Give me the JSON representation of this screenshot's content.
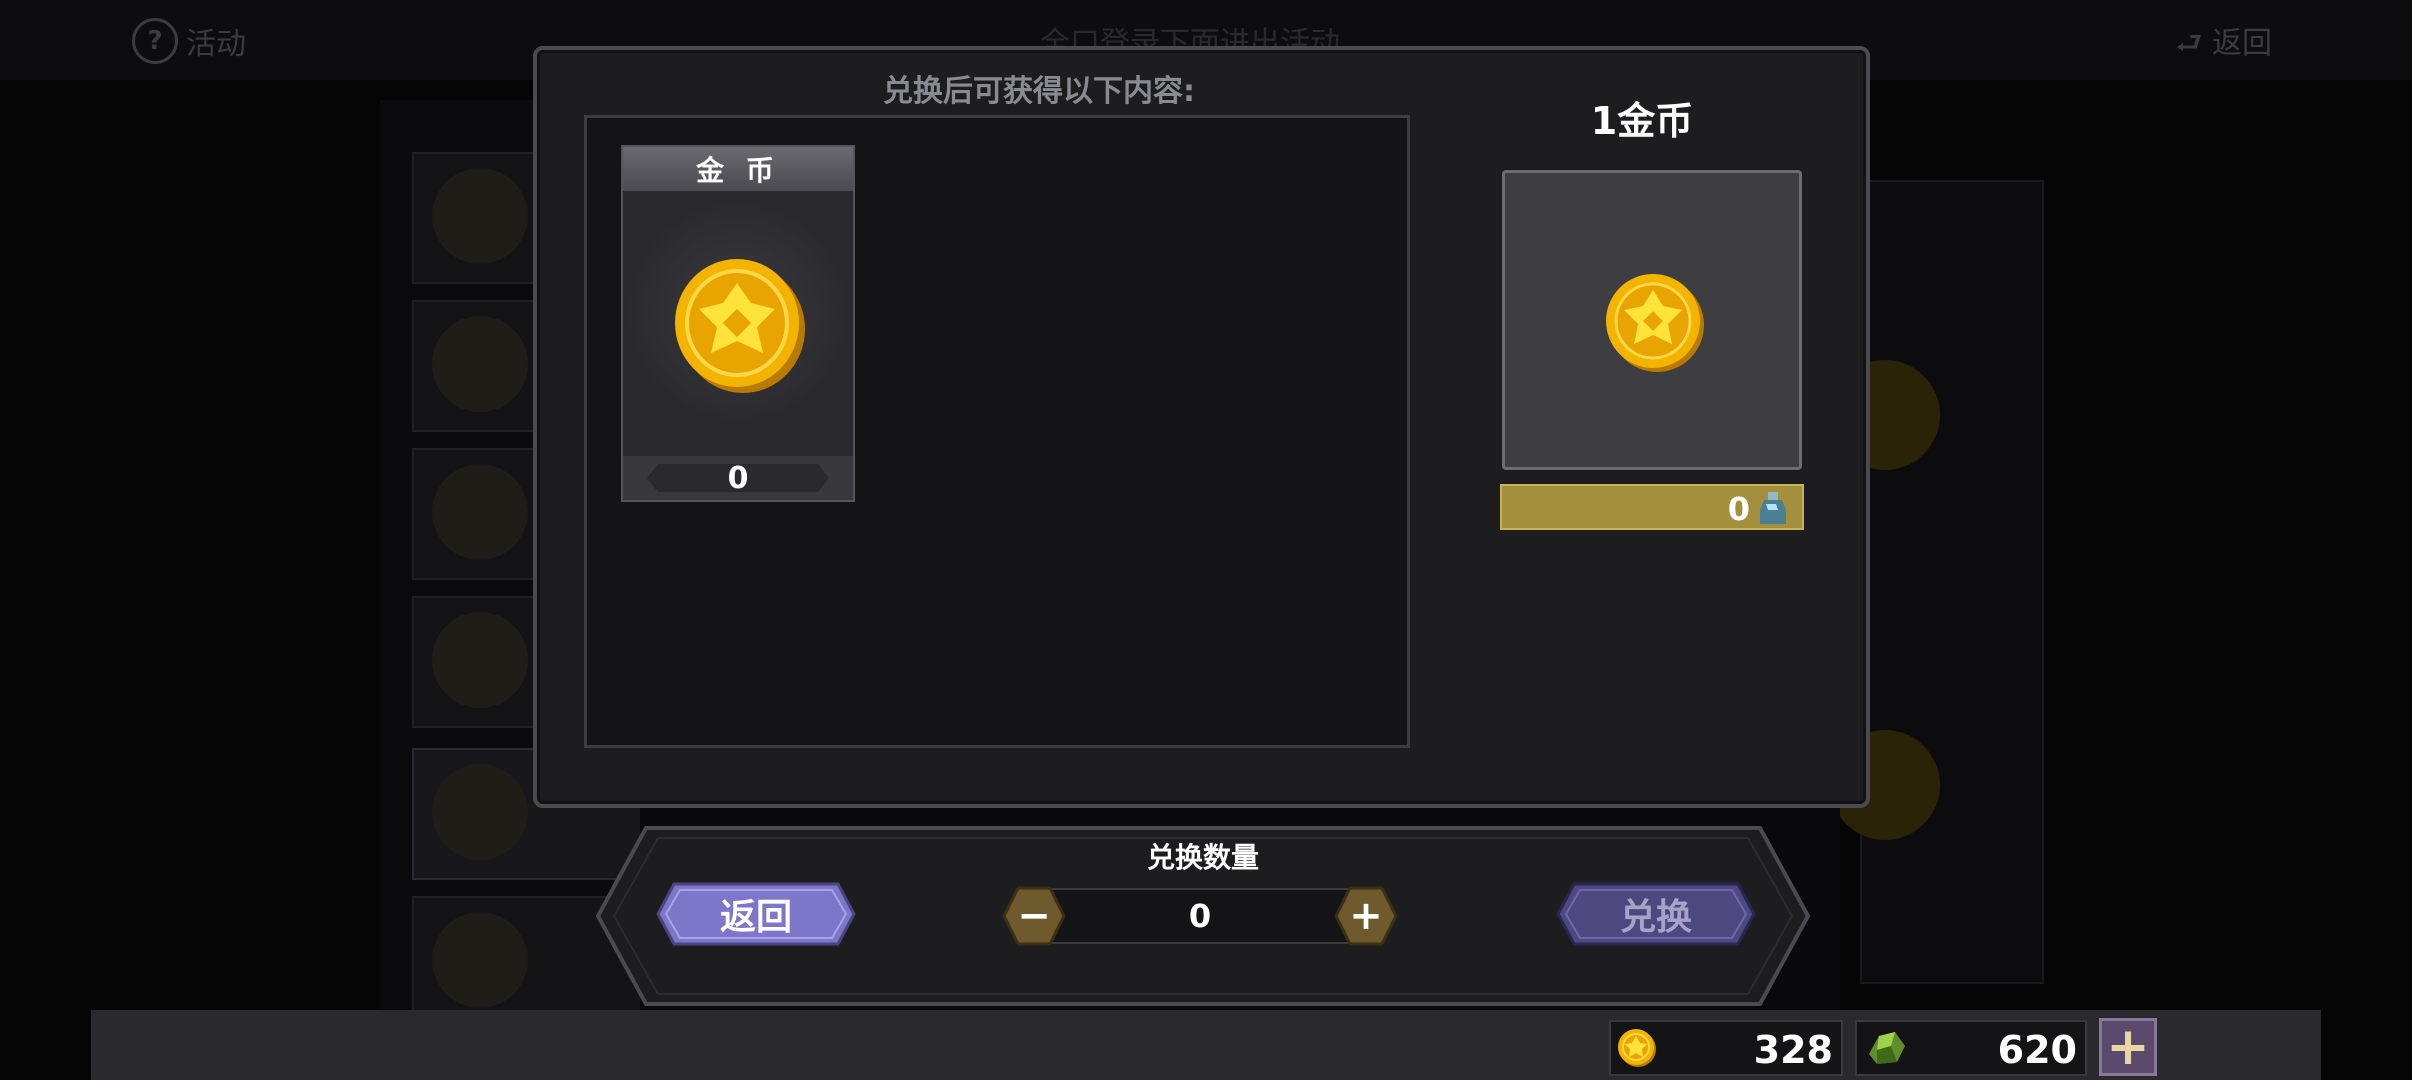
{
  "background": {
    "help_label": "活动",
    "back_label": "返回",
    "title_text": "全口登录下面进出活动"
  },
  "dialog": {
    "heading": "兑换后可获得以下内容:",
    "reward_item": {
      "name": "金 币",
      "count": "0",
      "icon": "gold-coin-icon"
    },
    "target": {
      "title": "1金币",
      "count": "0",
      "icon": "gold-coin-icon",
      "cost_icon": "bottle-icon"
    }
  },
  "exchange": {
    "quantity_label": "兑换数量",
    "quantity_value": "0",
    "minus_label": "−",
    "plus_label": "+",
    "back_button": "返回",
    "exchange_button": "兑换"
  },
  "currency": {
    "gold": "328",
    "gem": "620",
    "add_label": "+"
  },
  "colors": {
    "accent_purple": "#7d76c9",
    "gold_bar": "#a38f3c",
    "coin_gold": "#f2b400"
  }
}
